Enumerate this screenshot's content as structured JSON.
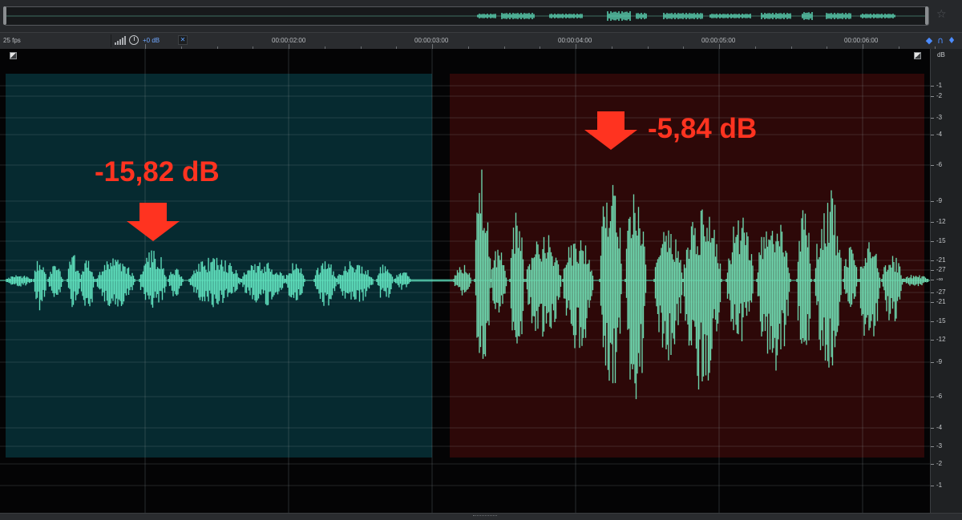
{
  "toolbar": {
    "fps_label": "25 fps",
    "gain_label": "+0 dB",
    "ruler_labels": [
      "00:00:02:00",
      "00:00:03:00",
      "00:00:04:00",
      "00:00:05:00",
      "00:00:06:00"
    ]
  },
  "annotations": {
    "left_level": "-15,82 dB",
    "right_level": "-5,84 dB"
  },
  "db_scale": {
    "unit": "dB",
    "labels": [
      "-1",
      "-2",
      "-3",
      "-4",
      "-6",
      "-9",
      "-12",
      "-15",
      "-21",
      "-27",
      "-∞",
      "-27",
      "-21",
      "-15",
      "-12",
      "-9",
      "-6",
      "-4",
      "-3",
      "-2",
      "-1"
    ]
  },
  "regions": {
    "left_color": "#062a30",
    "right_color": "#2d0808"
  },
  "waveform": {
    "color": "#5fe0bd",
    "right_color": "#6ed6ad",
    "annotation_color": "#ff3320"
  },
  "icons": [
    "star-icon",
    "level-meter-icon",
    "gain-knob-icon",
    "pin-icon",
    "snap-icon",
    "zoom-icon",
    "marker-icon",
    "corner-select-icon",
    "down-arrow-icon"
  ]
}
